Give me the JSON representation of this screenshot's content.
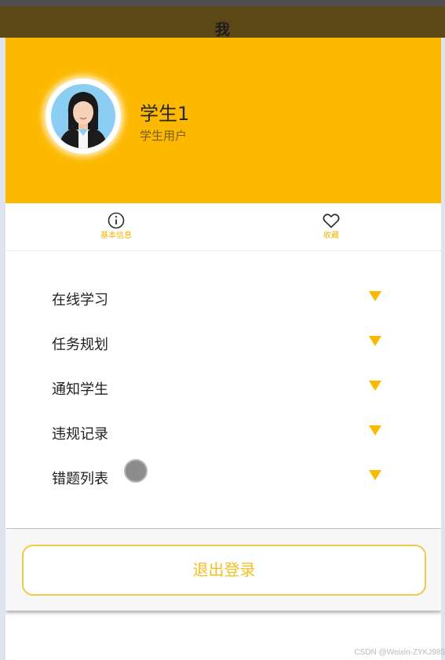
{
  "navbar": {
    "title": "我"
  },
  "profile": {
    "name": "学生1",
    "role": "学生用户"
  },
  "tabs": [
    {
      "label": "基本信息",
      "icon": "info-icon"
    },
    {
      "label": "收藏",
      "icon": "heart-icon"
    }
  ],
  "menu": {
    "items": [
      {
        "label": "在线学习"
      },
      {
        "label": "任务规划"
      },
      {
        "label": "通知学生"
      },
      {
        "label": "违规记录"
      },
      {
        "label": "错题列表"
      }
    ],
    "arrow_icon": "triangle-down-icon"
  },
  "logout": {
    "label": "退出登录"
  },
  "watermark": "CSDN @Weixin-ZYKJ985",
  "colors": {
    "accent": "#fdb900",
    "navbar": "#5c4716",
    "logout_text": "#f5bf1d"
  }
}
